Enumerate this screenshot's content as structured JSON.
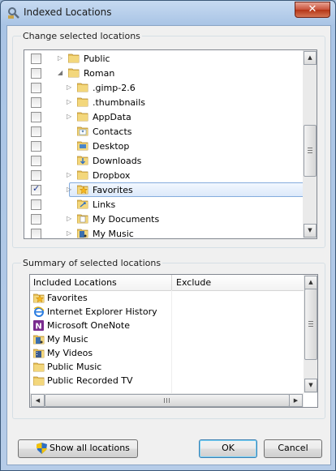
{
  "window": {
    "title": "Indexed Locations",
    "close_label": "✕"
  },
  "change_section": {
    "label": "Change selected locations",
    "rows": [
      {
        "label": "Public",
        "checked": false,
        "expandable": true,
        "icon": "folder-icon"
      },
      {
        "label": "Roman",
        "checked": false,
        "expandable": true,
        "expanded": true,
        "icon": "folder-icon"
      },
      {
        "label": ".gimp-2.6",
        "checked": false,
        "expandable": true,
        "icon": "folder-icon"
      },
      {
        "label": ".thumbnails",
        "checked": false,
        "expandable": true,
        "icon": "folder-icon"
      },
      {
        "label": "AppData",
        "checked": false,
        "expandable": true,
        "icon": "folder-icon"
      },
      {
        "label": "Contacts",
        "checked": false,
        "expandable": false,
        "icon": "contacts-folder-icon"
      },
      {
        "label": "Desktop",
        "checked": false,
        "expandable": false,
        "icon": "desktop-folder-icon"
      },
      {
        "label": "Downloads",
        "checked": false,
        "expandable": false,
        "icon": "downloads-folder-icon"
      },
      {
        "label": "Dropbox",
        "checked": false,
        "expandable": true,
        "icon": "folder-icon"
      },
      {
        "label": "Favorites",
        "checked": true,
        "expandable": true,
        "selected": true,
        "icon": "favorites-folder-icon"
      },
      {
        "label": "Links",
        "checked": false,
        "expandable": false,
        "icon": "links-folder-icon"
      },
      {
        "label": "My Documents",
        "checked": false,
        "expandable": true,
        "icon": "documents-folder-icon"
      },
      {
        "label": "My Music",
        "checked": false,
        "expandable": true,
        "icon": "music-folder-icon"
      }
    ]
  },
  "summary_section": {
    "label": "Summary of selected locations",
    "columns": [
      "Included Locations",
      "Exclude"
    ],
    "rows": [
      {
        "label": "Favorites",
        "icon": "favorites-folder-icon"
      },
      {
        "label": "Internet Explorer History",
        "icon": "internet-explorer-icon"
      },
      {
        "label": "Microsoft OneNote",
        "icon": "onenote-icon"
      },
      {
        "label": "My Music",
        "icon": "music-folder-icon"
      },
      {
        "label": "My Videos",
        "icon": "videos-folder-icon"
      },
      {
        "label": "Public Music",
        "icon": "folder-icon"
      },
      {
        "label": "Public Recorded TV",
        "icon": "folder-icon"
      }
    ]
  },
  "buttons": {
    "show_all": "Show all locations",
    "ok": "OK",
    "cancel": "Cancel"
  },
  "colors": {
    "selection": "#dce9fa",
    "window_frame": "#a9c4e5",
    "close_button": "#c8523a"
  }
}
